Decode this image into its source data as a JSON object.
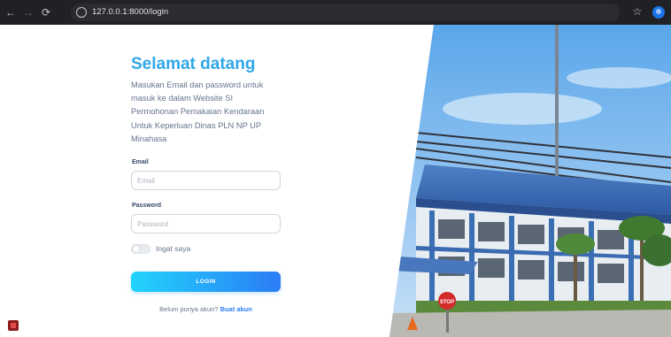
{
  "browser": {
    "url": "127.0.0.1:8000/login",
    "back_icon": "arrow-left-icon",
    "forward_icon": "arrow-right-icon",
    "reload_icon": "reload-icon",
    "site_info_icon": "site-info-icon",
    "bookmark_icon": "star-icon",
    "profile_icon": "profile-avatar-icon"
  },
  "login": {
    "title": "Selamat datang",
    "description": "Masukan Email dan password untuk masuk ke dalam Website SI Permohonan Pemakaian Kendaraan Untuk Keperluan Dinas PLN NP UP Minahasa",
    "email_label": "Email",
    "email_placeholder": "Email",
    "email_value": "",
    "password_label": "Password",
    "password_placeholder": "Password",
    "password_value": "",
    "remember_label": "Ingat saya",
    "remember_checked": false,
    "login_button": "LOGIN",
    "signup_prompt": "Belum punya akun?",
    "signup_link": "Buat akun"
  },
  "colors": {
    "title": "#2fa7e8",
    "button_gradient_start": "#21d4fd",
    "button_gradient_end": "#2b7cf5",
    "link": "#2b7cf5",
    "browser_bar": "#202124"
  },
  "photo": {
    "subject": "office-building-photo",
    "sign_text": "STOP"
  }
}
